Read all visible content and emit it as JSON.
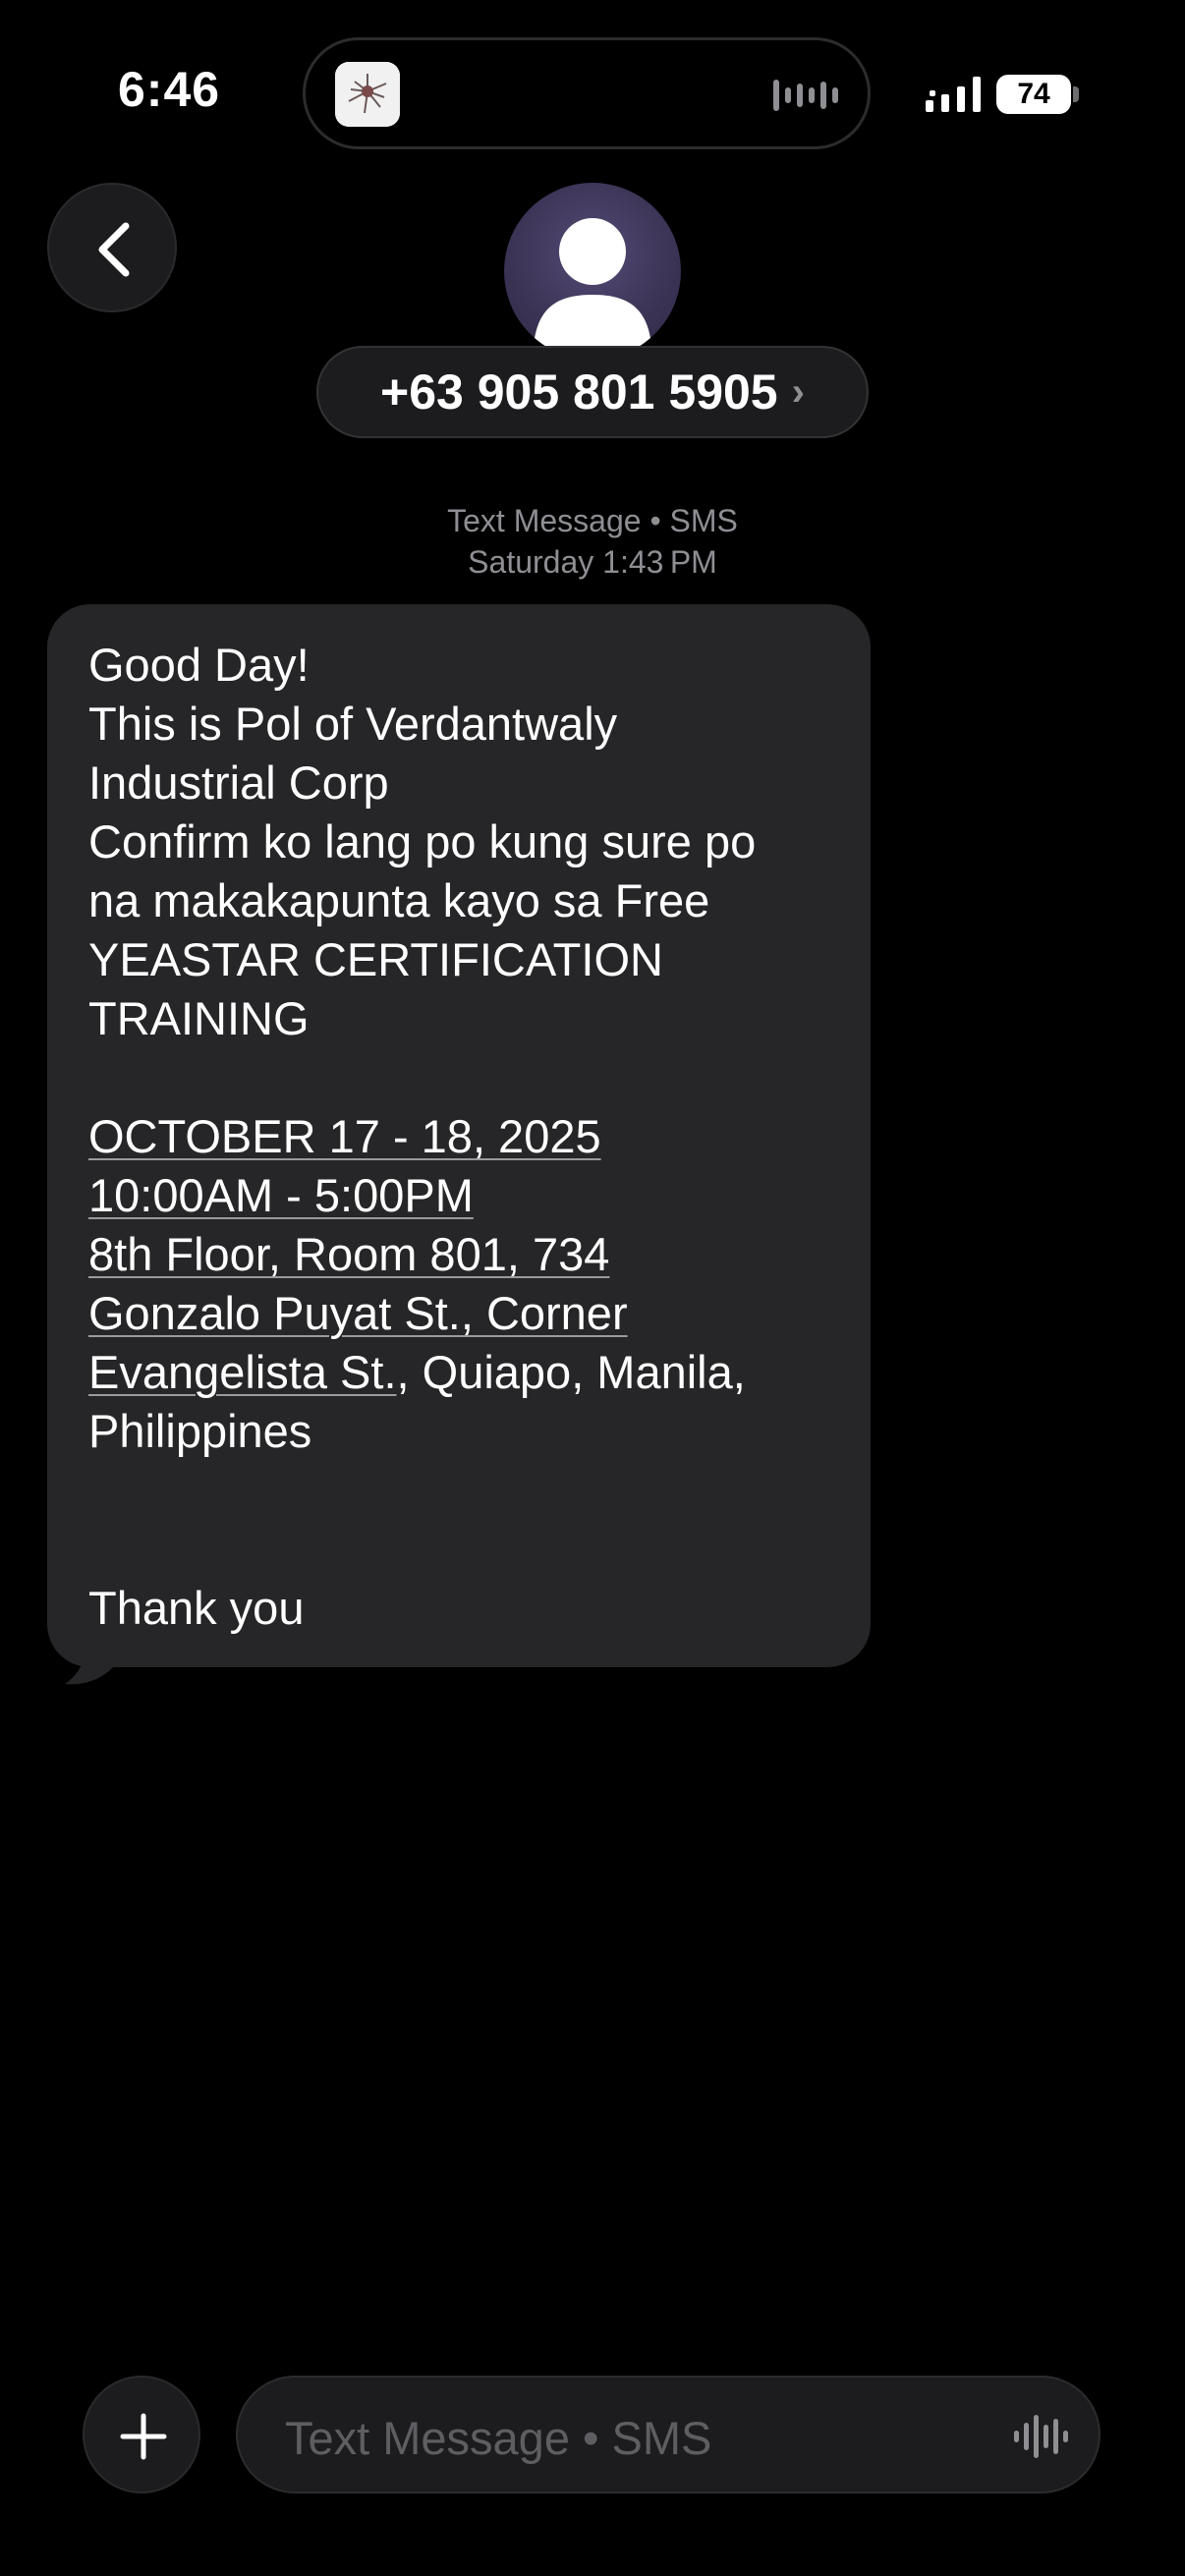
{
  "status_bar": {
    "time": "6:46",
    "battery": "74"
  },
  "header": {
    "contact": "+63 905 801 5905",
    "chevron": "›"
  },
  "conversation": {
    "service": "Text Message • SMS",
    "timestamp_day": "Saturday",
    "timestamp_time": "1:43 PM"
  },
  "message": {
    "line_1": "Good Day!",
    "line_2": "This is Pol of Verdantwaly",
    "line_3": "Industrial Corp",
    "line_4": "Confirm ko lang po kung sure po",
    "line_5": "na makakapunta kayo sa Free",
    "line_6": "YEASTAR CERTIFICATION",
    "line_7": "TRAINING",
    "date_link": "OCTOBER 17 - 18, 2025",
    "time_link": "10:00AM - 5:00PM",
    "address_1": "8th Floor, Room 801, 734",
    "address_2": "Gonzalo Puyat St., Corner",
    "address_3": "Evangelista St.",
    "address_3_rest": ", Quiapo, Manila,",
    "address_4": "Philippines",
    "closing": "Thank you"
  },
  "composer": {
    "placeholder": "Text Message • SMS"
  },
  "colors": {
    "background": "#000000",
    "bubble": "#262628",
    "secondary_text": "#8e8e93"
  },
  "icons": {
    "back": "chevron-left-icon",
    "avatar": "person-icon",
    "add": "plus-icon",
    "audio": "waveform-icon"
  }
}
